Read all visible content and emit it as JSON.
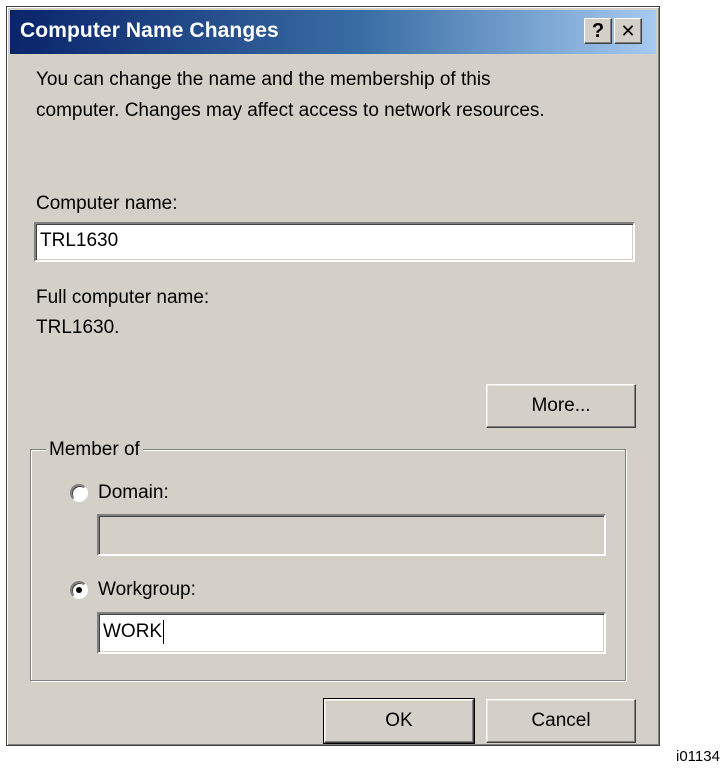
{
  "window": {
    "title": "Computer Name Changes",
    "help_glyph": "?",
    "close_glyph": "✕",
    "icons": [
      "help-icon",
      "close-icon"
    ]
  },
  "description": {
    "line1": "You can change the name and the membership of this",
    "line2": "computer. Changes may affect access to network resources."
  },
  "computer_name": {
    "label": "Computer name:",
    "value": "TRL1630"
  },
  "full_computer_name": {
    "label": "Full computer name:",
    "value": "TRL1630."
  },
  "more_button": {
    "label": "More..."
  },
  "member_of": {
    "legend": "Member of",
    "domain": {
      "label": "Domain:",
      "selected": false,
      "value": ""
    },
    "workgroup": {
      "label": "Workgroup:",
      "selected": true,
      "value": "WORK"
    }
  },
  "buttons": {
    "ok": "OK",
    "cancel": "Cancel"
  },
  "figure_id": "i01134",
  "colors": {
    "dialog_bg": "#d4d0c8",
    "title_gradient_start": "#0a246a",
    "title_gradient_end": "#a6caf0",
    "title_text": "#ffffff"
  }
}
